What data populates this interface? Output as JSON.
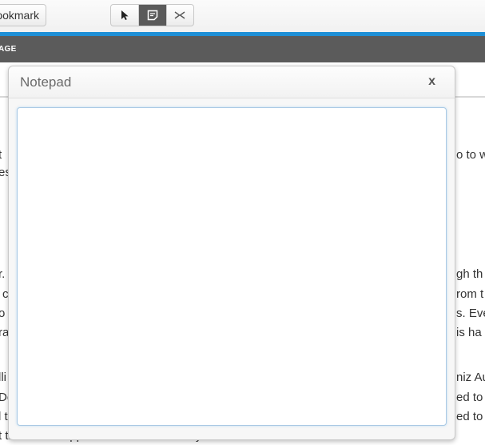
{
  "toolbar": {
    "bookmark_label": "ookmark",
    "tools": [
      {
        "name": "pointer-icon",
        "active": false
      },
      {
        "name": "note-icon",
        "active": true
      },
      {
        "name": "highlight-icon",
        "active": false
      }
    ]
  },
  "nav": {
    "label": "AGE"
  },
  "background_text": [
    {
      "text": "t"
    },
    {
      "text": "es"
    },
    {
      "text": "o to w"
    },
    {
      "text": "r."
    },
    {
      "text": "gh th"
    },
    {
      "text": "c"
    },
    {
      "text": "rom t"
    },
    {
      "text": "o"
    },
    {
      "text": "s. Eve"
    },
    {
      "text": "ra"
    },
    {
      "text": "is ha"
    },
    {
      "text": "lli"
    },
    {
      "text": "niz Au"
    },
    {
      "text": "De"
    },
    {
      "text": "ed to a"
    },
    {
      "text": "l t"
    },
    {
      "text": "ed to s"
    },
    {
      "text": "t that would appeal to the whole family."
    }
  ],
  "notepad": {
    "title": "Notepad",
    "close_label": "x",
    "text": ""
  },
  "colors": {
    "accent": "#1e8fd6",
    "nav_bar": "#5b5b5b"
  }
}
